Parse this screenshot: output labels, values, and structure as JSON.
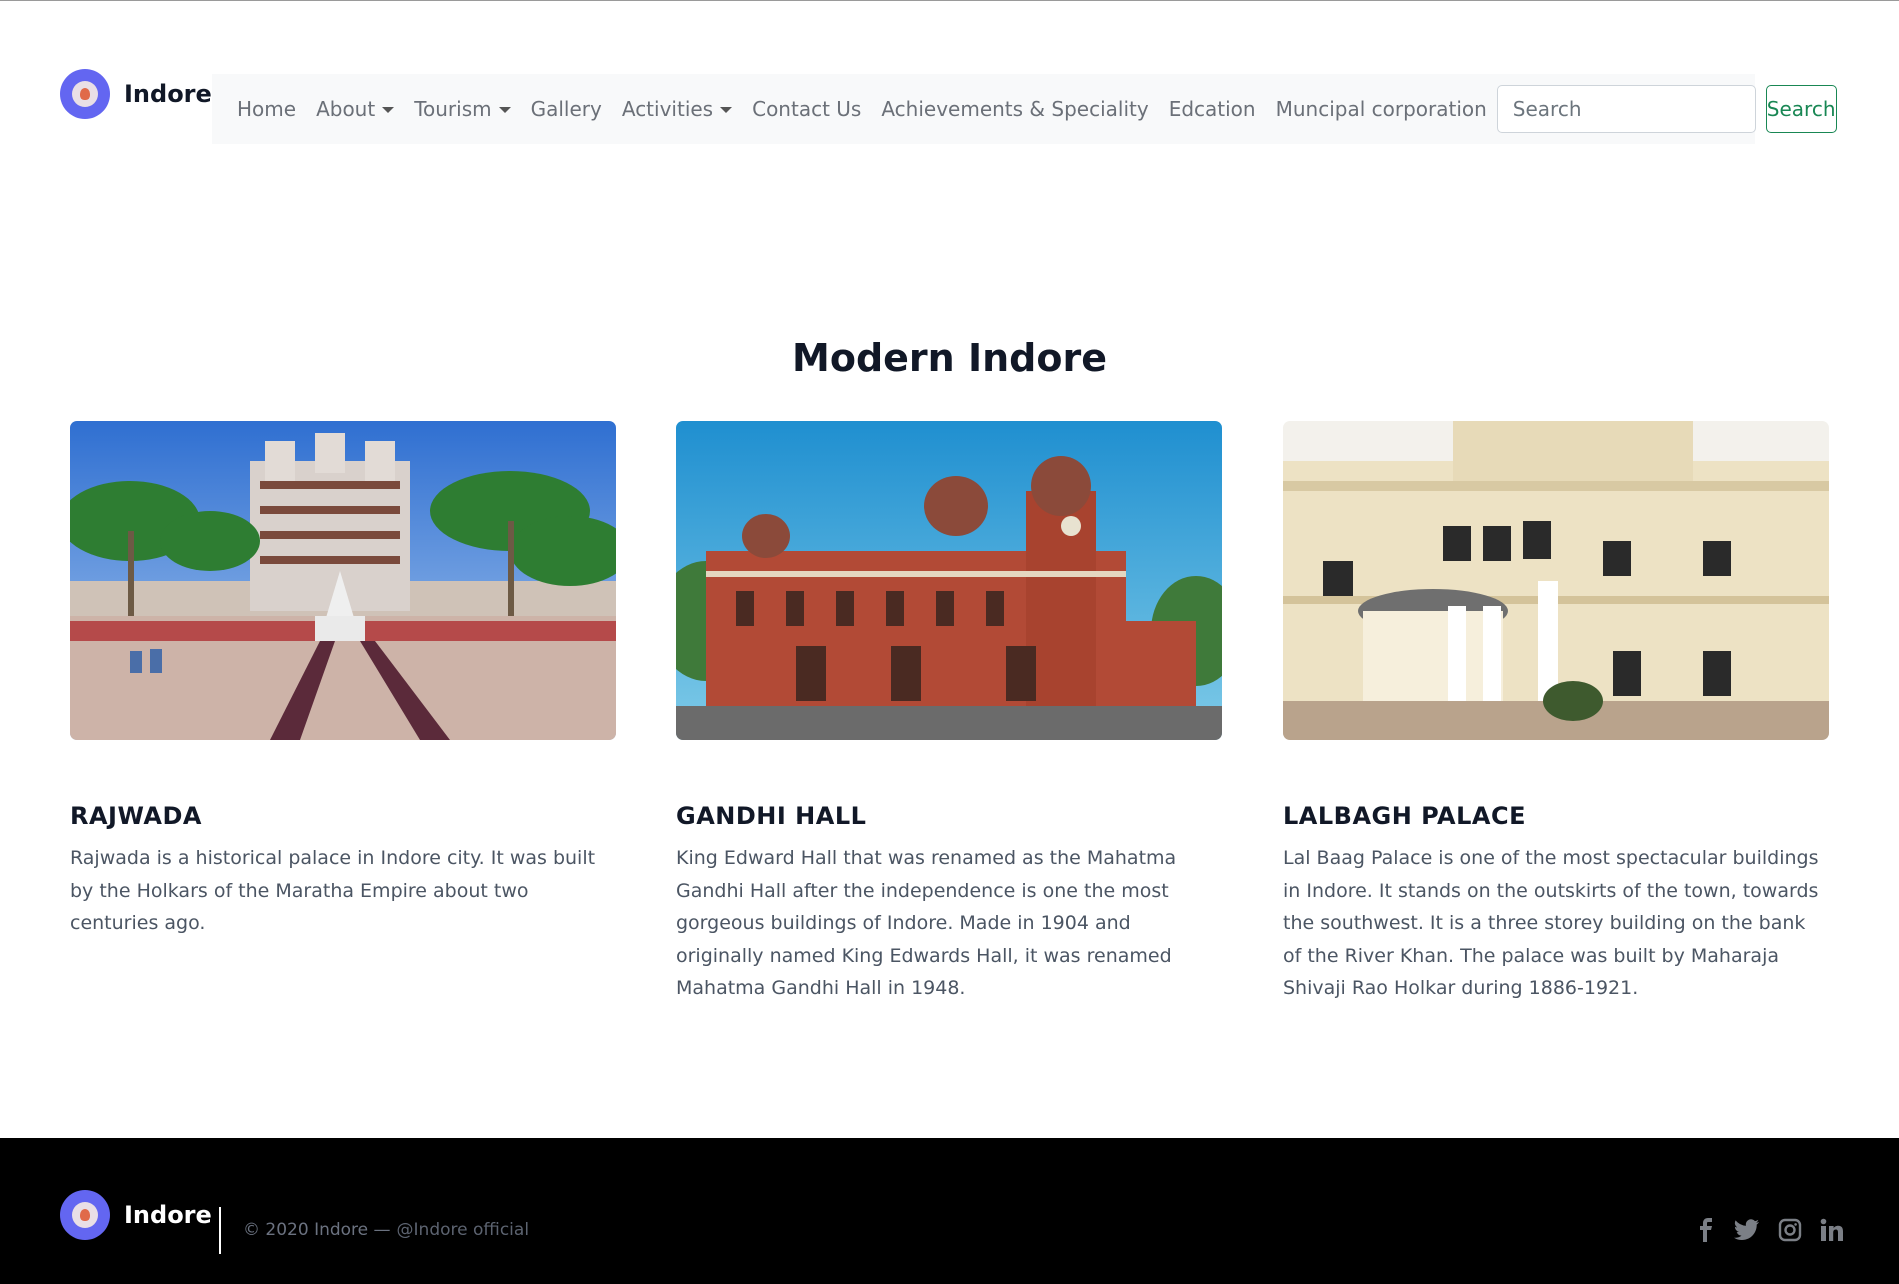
{
  "brand": {
    "name": "Indore"
  },
  "nav": {
    "items": [
      {
        "label": "Home",
        "dropdown": false
      },
      {
        "label": "About",
        "dropdown": true
      },
      {
        "label": "Tourism",
        "dropdown": true
      },
      {
        "label": "Gallery",
        "dropdown": false
      },
      {
        "label": "Activities",
        "dropdown": true
      },
      {
        "label": "Contact Us",
        "dropdown": false
      },
      {
        "label": "Achievements & Speciality",
        "dropdown": false
      },
      {
        "label": "Edcation",
        "dropdown": false
      },
      {
        "label": "Muncipal corporation",
        "dropdown": false
      }
    ],
    "search_placeholder": "Search",
    "search_button": "Search"
  },
  "section": {
    "title": "Modern Indore",
    "cards": [
      {
        "title": "RAJWADA",
        "text": "Rajwada is a historical palace in Indore city. It was built by the Holkars of the Maratha Empire about two centuries ago."
      },
      {
        "title": "GANDHI HALL",
        "text": "King Edward Hall that was renamed as the Mahatma Gandhi Hall after the independence is one the most gorgeous buildings of Indore. Made in 1904 and originally named King Edwards Hall, it was renamed Mahatma Gandhi Hall in 1948."
      },
      {
        "title": "LALBAGH PALACE",
        "text": "Lal Baag Palace is one of the most spectacular buildings in Indore. It stands on the outskirts of the town, towards the southwest. It is a three storey building on the bank of the River Khan. The palace was built by Maharaja Shivaji Rao Holkar during 1886-1921."
      }
    ]
  },
  "footer": {
    "brand": "Indore",
    "copyright": "© 2020 Indore —",
    "handle": "@Indore official",
    "socials": [
      "facebook-icon",
      "twitter-icon",
      "instagram-icon",
      "linkedin-icon"
    ]
  },
  "colors": {
    "accent": "#6366f1",
    "search_button": "#198754",
    "footer_bg": "#000000",
    "navbar_bg": "#f8f9fa"
  }
}
